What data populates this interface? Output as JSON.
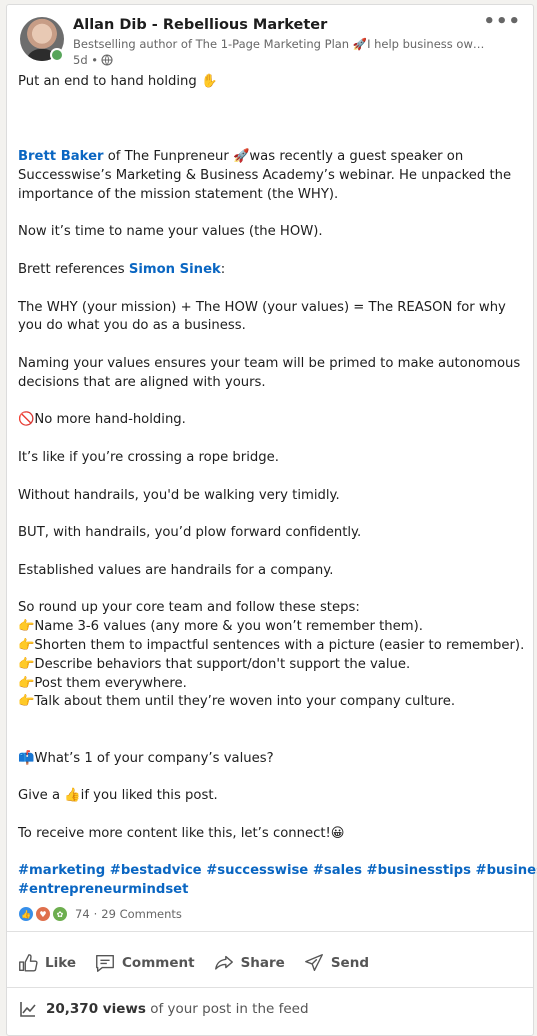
{
  "author": {
    "name": "Allan Dib - Rebellious Marketer",
    "headline": "Bestselling author of The 1-Page Marketing Plan 🚀I help business ow…",
    "time": "5d •",
    "more_label": "•••"
  },
  "post": {
    "lines": [
      {
        "text": "Put an end to hand holding ✋"
      },
      {
        "text": ""
      },
      {
        "text": ""
      },
      {
        "text": ""
      },
      {
        "parts": [
          {
            "t": "Brett Baker",
            "link": true
          },
          {
            "t": " of The Funpreneur 🚀was recently a guest speaker on"
          }
        ]
      },
      {
        "text": "Successwise’s Marketing & Business Academy’s webinar. He unpacked the"
      },
      {
        "text": "importance of the mission statement (the WHY)."
      },
      {
        "text": ""
      },
      {
        "text": "Now it’s time to name your values (the HOW)."
      },
      {
        "text": ""
      },
      {
        "parts": [
          {
            "t": "Brett references "
          },
          {
            "t": "Simon Sinek",
            "link": true
          },
          {
            "t": ":"
          }
        ]
      },
      {
        "text": ""
      },
      {
        "text": "The WHY (your mission) + The HOW (your values) = The REASON for why"
      },
      {
        "text": "you do what you do as a business."
      },
      {
        "text": ""
      },
      {
        "text": "Naming your values ensures your team will be primed to make autonomous"
      },
      {
        "text": "decisions that are aligned with yours."
      },
      {
        "text": ""
      },
      {
        "text": "🚫No more hand-holding."
      },
      {
        "text": ""
      },
      {
        "text": "It’s like if you’re crossing a rope bridge."
      },
      {
        "text": ""
      },
      {
        "text": "Without handrails, you'd be walking very timidly."
      },
      {
        "text": ""
      },
      {
        "text": "BUT, with handrails, you’d plow forward confidently."
      },
      {
        "text": ""
      },
      {
        "text": "Established values are handrails for a company."
      },
      {
        "text": ""
      },
      {
        "text": "So round up your core team and follow these steps:"
      },
      {
        "text": "👉Name 3-6 values (any more & you won’t remember them)."
      },
      {
        "text": "👉Shorten them to impactful sentences with a picture (easier to remember)."
      },
      {
        "text": "👉Describe behaviors that support/don't support the value."
      },
      {
        "text": "👉Post them everywhere."
      },
      {
        "text": "👉Talk about them until they’re woven into your company culture."
      },
      {
        "text": ""
      },
      {
        "text": ""
      },
      {
        "text": "📫What’s 1 of your company’s values?"
      },
      {
        "text": ""
      },
      {
        "text": "Give a 👍if you liked this post."
      },
      {
        "text": ""
      },
      {
        "text": "To receive more content like this, let’s connect!😀"
      },
      {
        "text": ""
      },
      {
        "hashtags": "#marketing #bestadvice #successwise #sales #businesstips #business"
      },
      {
        "hashtags": "#entrepreneurmindset"
      }
    ]
  },
  "social": {
    "reactions_count": "74",
    "separator": "·",
    "comments": "29 Comments"
  },
  "actions": [
    {
      "label": "Like",
      "icon": "like-icon"
    },
    {
      "label": "Comment",
      "icon": "comment-icon"
    },
    {
      "label": "Share",
      "icon": "share-icon"
    },
    {
      "label": "Send",
      "icon": "send-icon"
    }
  ],
  "analytics": {
    "views_count": "20,370 views",
    "views_suffix": "of your post in the feed"
  },
  "colors": {
    "link": "#0a66c2",
    "online": "#57a55a"
  }
}
